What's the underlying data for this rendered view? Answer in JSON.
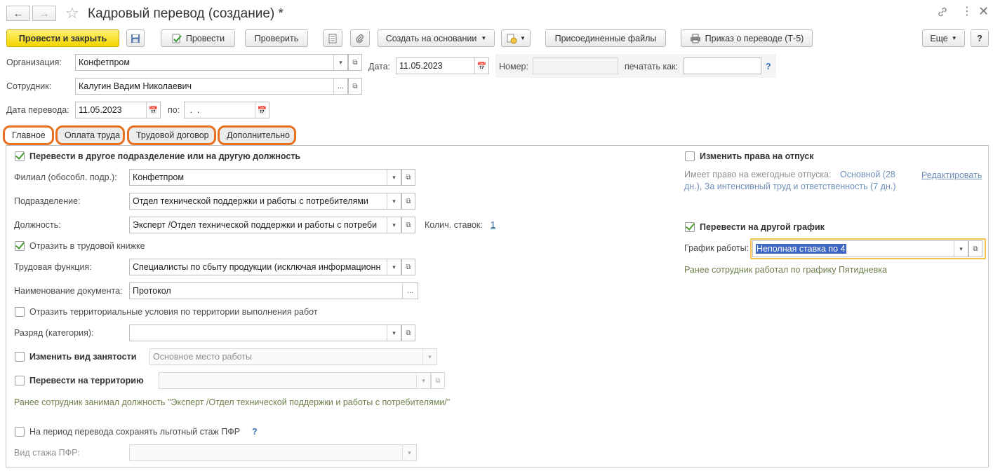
{
  "window": {
    "title": "Кадровый перевод (создание) *"
  },
  "toolbar": {
    "post_close": "Провести и закрыть",
    "post": "Провести",
    "check": "Проверить",
    "create_based_on": "Создать на основании",
    "attached_files": "Присоединенные файлы",
    "transfer_order": "Приказ о переводе (Т-5)",
    "more": "Еще",
    "help": "?"
  },
  "header": {
    "organization_label": "Организация:",
    "organization_value": "Конфетпром",
    "date_label": "Дата:",
    "date_value": "11.05.2023",
    "number_label": "Номер:",
    "number_value": "",
    "print_as_label": "печатать как:",
    "print_as_value": "",
    "print_help": "?",
    "employee_label": "Сотрудник:",
    "employee_value": "Калугин Вадим Николаевич",
    "transfer_date_label": "Дата перевода:",
    "transfer_date_value": "11.05.2023",
    "to_label": "по:",
    "to_value": " .  ."
  },
  "tabs": [
    {
      "label": "Главное"
    },
    {
      "label": "Оплата труда"
    },
    {
      "label": "Трудовой договор"
    },
    {
      "label": "Дополнительно"
    }
  ],
  "main": {
    "transfer_dept_label": "Перевести в другое подразделение или на другую должность",
    "transfer_dept_checked": true,
    "branch_label": "Филиал (обособл. подр.):",
    "branch_value": "Конфетпром",
    "department_label": "Подразделение:",
    "department_value": "Отдел технической поддержки и работы с потребителями",
    "position_label": "Должность:",
    "position_value": "Эксперт /Отдел технической поддержки и работы с потреби",
    "rates_label": "Колич. ставок:",
    "rates_value": "1",
    "workbook_label": "Отразить в трудовой книжке",
    "workbook_checked": true,
    "labor_function_label": "Трудовая функция:",
    "labor_function_value": "Специалисты по сбыту продукции (исключая информационн",
    "doc_name_label": "Наименование документа:",
    "doc_name_value": "Протокол",
    "territorial_label": "Отразить территориальные условия по территории выполнения работ",
    "territorial_checked": false,
    "grade_label": "Разряд (категория):",
    "grade_value": "",
    "employment_type_label": "Изменить вид занятости",
    "employment_type_checked": false,
    "employment_type_value": "Основное место работы",
    "territory_label": "Перевести на территорию",
    "territory_checked": false,
    "territory_value": "",
    "previous_position_note": "Ранее сотрудник занимал должность \"Эксперт /Отдел технической поддержки и работы с потребителями/\"",
    "pfr_label": "На период перевода сохранять льготный стаж ПФР",
    "pfr_checked": false,
    "pfr_help": "?",
    "pfr_type_label": "Вид стажа ПФР:",
    "pfr_type_value": ""
  },
  "right": {
    "vacation_label": "Изменить права на отпуск",
    "vacation_checked": false,
    "vacation_info_1": "Имеет право на ежегодные отпуска:",
    "vacation_info_link_1": "Основной (28",
    "vacation_info_link_2": "дн.), За интенсивный труд и ответственность (7 дн.)",
    "edit_link": "Редактировать",
    "schedule_label": "Перевести на другой график",
    "schedule_checked": true,
    "work_schedule_label": "График работы:",
    "work_schedule_value": "Неполная ставка по 4",
    "previous_schedule_note": "Ранее сотрудник работал по графику Пятидневка"
  },
  "colors": {
    "accent_orange": "#e8701f",
    "primary_yellow": "#f3d500",
    "check_green": "#4a9a2c",
    "note_green": "#6d7f4b",
    "link_blue": "#1f5f9a"
  }
}
